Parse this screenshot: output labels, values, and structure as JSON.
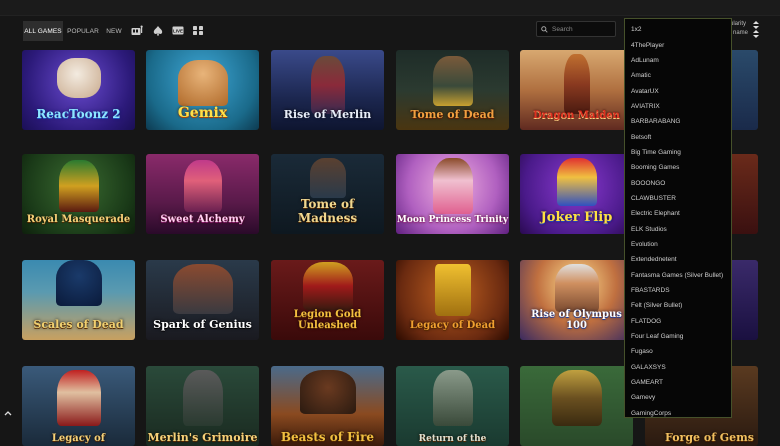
{
  "tabs": [
    {
      "label": "ALL GAMES",
      "active": true
    },
    {
      "label": "POPULAR",
      "active": false
    },
    {
      "label": "NEW",
      "active": false
    }
  ],
  "category_icons": [
    "slots-icon",
    "card-suit-icon",
    "live-dealer-icon",
    "grid-icon"
  ],
  "search": {
    "placeholder": "Search"
  },
  "sort": {
    "line1": "ularity",
    "line2": "name"
  },
  "games": [
    [
      "ReacToonz 2",
      "Gemix",
      "Rise of Merlin",
      "Tome of Dead",
      "Dragon Maiden",
      ""
    ],
    [
      "Royal Masquerade",
      "Sweet Alchemy",
      "Tome of Madness",
      "Moon Princess Trinity",
      "Joker Flip",
      ""
    ],
    [
      "Scales of Dead",
      "Spark of Genius",
      "Legion Gold Unleashed",
      "Legacy of Dead",
      "Rise of Olympus 100",
      ""
    ],
    [
      "Legacy of",
      "Merlin's Grimoire",
      "Beasts of Fire",
      "Return of the",
      "",
      "Forge of Gems"
    ]
  ],
  "providers": [
    "1x2",
    "4ThePlayer",
    "AdLunam",
    "Amatic",
    "AvatarUX",
    "AVIATRIX",
    "BARBARABANG",
    "Betsoft",
    "Big Time Gaming",
    "Booming Games",
    "BOOONGO",
    "CLAWBUSTER",
    "Electric Elephant",
    "ELK Studios",
    "Evolution",
    "Extendednetent",
    "Fantasma Games (Silver Bullet)",
    "FBASTARDS",
    "Felt (Silver Bullet)",
    "FLATDOG",
    "Four Leaf Gaming",
    "Fugaso",
    "GALAXSYS",
    "GAMEART",
    "Gamevy",
    "GamingCorps",
    "GAMZIX"
  ],
  "colors": {
    "accent_border": "#46512a",
    "title_gold": "#f4d27a",
    "background": "#161616"
  }
}
